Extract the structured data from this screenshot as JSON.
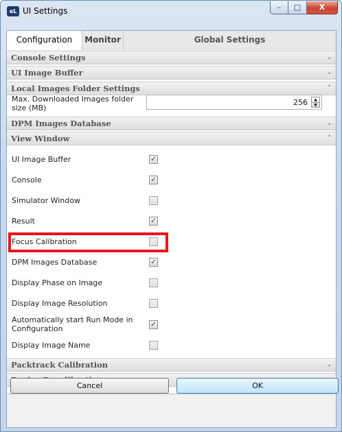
{
  "window": {
    "title": "UI Settings",
    "app_icon_text": "αL",
    "buttons": {
      "minimize": "–",
      "maximize": "□",
      "close": "X"
    }
  },
  "tabs": [
    {
      "label": "Configuration",
      "active": true
    },
    {
      "label": "Monitor",
      "active": false
    },
    {
      "label": "Global Settings",
      "active": false
    }
  ],
  "sections": {
    "console": {
      "label": "Console Settings",
      "state": "collapsed"
    },
    "ui_image_buffer": {
      "label": "UI Image Buffer",
      "state": "collapsed"
    },
    "local_images": {
      "label": "Local Images Folder Settings",
      "state": "expanded"
    },
    "dpm_db": {
      "label": "DPM Images Database",
      "state": "collapsed"
    },
    "view_window": {
      "label": "View Window",
      "state": "expanded"
    },
    "packtrack": {
      "label": "Packtrack Calibration",
      "state": "collapsed"
    },
    "device_recal": {
      "label": "Device Recalibration",
      "state": "collapsed"
    }
  },
  "local_images": {
    "max_folder_label_line1": "Max. Downloaded Images folder",
    "max_folder_label_line2": "size (MB)",
    "max_folder_value": "256"
  },
  "view_window": {
    "items": [
      {
        "label": "UI Image Buffer",
        "checked": true
      },
      {
        "label": "Console",
        "checked": true
      },
      {
        "label": "Simulator Window",
        "checked": false
      },
      {
        "label": "Result",
        "checked": true
      },
      {
        "label": "Focus Calibration",
        "checked": false
      },
      {
        "label": "DPM Images Database",
        "checked": true
      },
      {
        "label": "Display Phase on Image",
        "checked": false
      },
      {
        "label": "Display Image Resolution",
        "checked": false
      },
      {
        "label_line1": "Automatically start Run Mode in",
        "label_line2": "Configuration",
        "checked": true
      },
      {
        "label": "Display Image Name",
        "checked": false
      }
    ]
  },
  "icons": {
    "chevron_down": "⌄",
    "chevron_up": "⌃",
    "check": "✓",
    "spin_up": "▲",
    "spin_down": "▼"
  },
  "footer": {
    "cancel_label": "Cancel",
    "ok_label": "OK"
  },
  "colors": {
    "highlight": "#e8141c",
    "ok_button": "#bee6fd"
  }
}
